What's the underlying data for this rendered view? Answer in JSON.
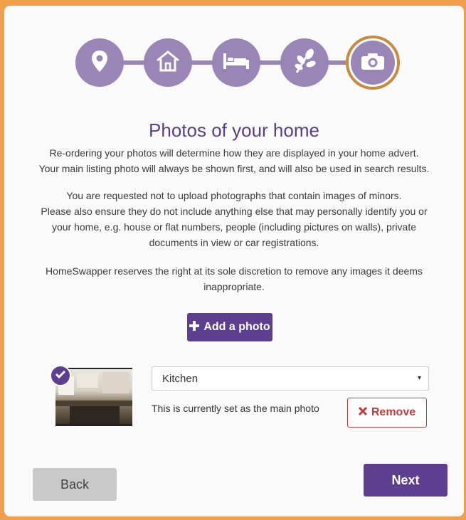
{
  "stepper": {
    "steps": [
      {
        "icon": "location-pin-icon",
        "active": false
      },
      {
        "icon": "house-icon",
        "active": false
      },
      {
        "icon": "bed-icon",
        "active": false
      },
      {
        "icon": "leaf-icon",
        "active": false
      },
      {
        "icon": "camera-icon",
        "active": true
      }
    ],
    "colors": {
      "inactive": "#9a86b6",
      "active_ring": "#c88a3c"
    }
  },
  "title": "Photos of your home",
  "paragraphs": {
    "p1_line1": "Re-ordering your photos will determine how they are displayed in your home advert.",
    "p1_line2": "Your main listing photo will always be shown first, and will also be used in search results.",
    "p2_line1": "You are requested not to upload photographs that contain images of minors.",
    "p2_line2": "Please also ensure they do not include anything else that may personally identify you or",
    "p2_line3": "your home, e.g. house or flat numbers, people (including pictures on walls), private",
    "p2_line4": "documents in view or car registrations.",
    "p3_line1": "HomeSwapper reserves the right at its sole discretion to remove any images it deems",
    "p3_line2": "inappropriate."
  },
  "add_button": {
    "icon": "plus-icon",
    "label": "Add a photo"
  },
  "photo": {
    "thumbnail_icon": "kitchen-photo",
    "badge_icon": "checkmark-icon",
    "room_select_value": "Kitchen",
    "main_note": "This is currently set as the main photo",
    "remove_icon": "x-icon",
    "remove_label": "Remove"
  },
  "nav": {
    "back_label": "Back",
    "next_label": "Next"
  },
  "colors": {
    "brand_purple": "#5e3e8f",
    "title_purple": "#5b3f86",
    "remove_red": "#c23b3b",
    "background_orange": "#f0a04b"
  }
}
